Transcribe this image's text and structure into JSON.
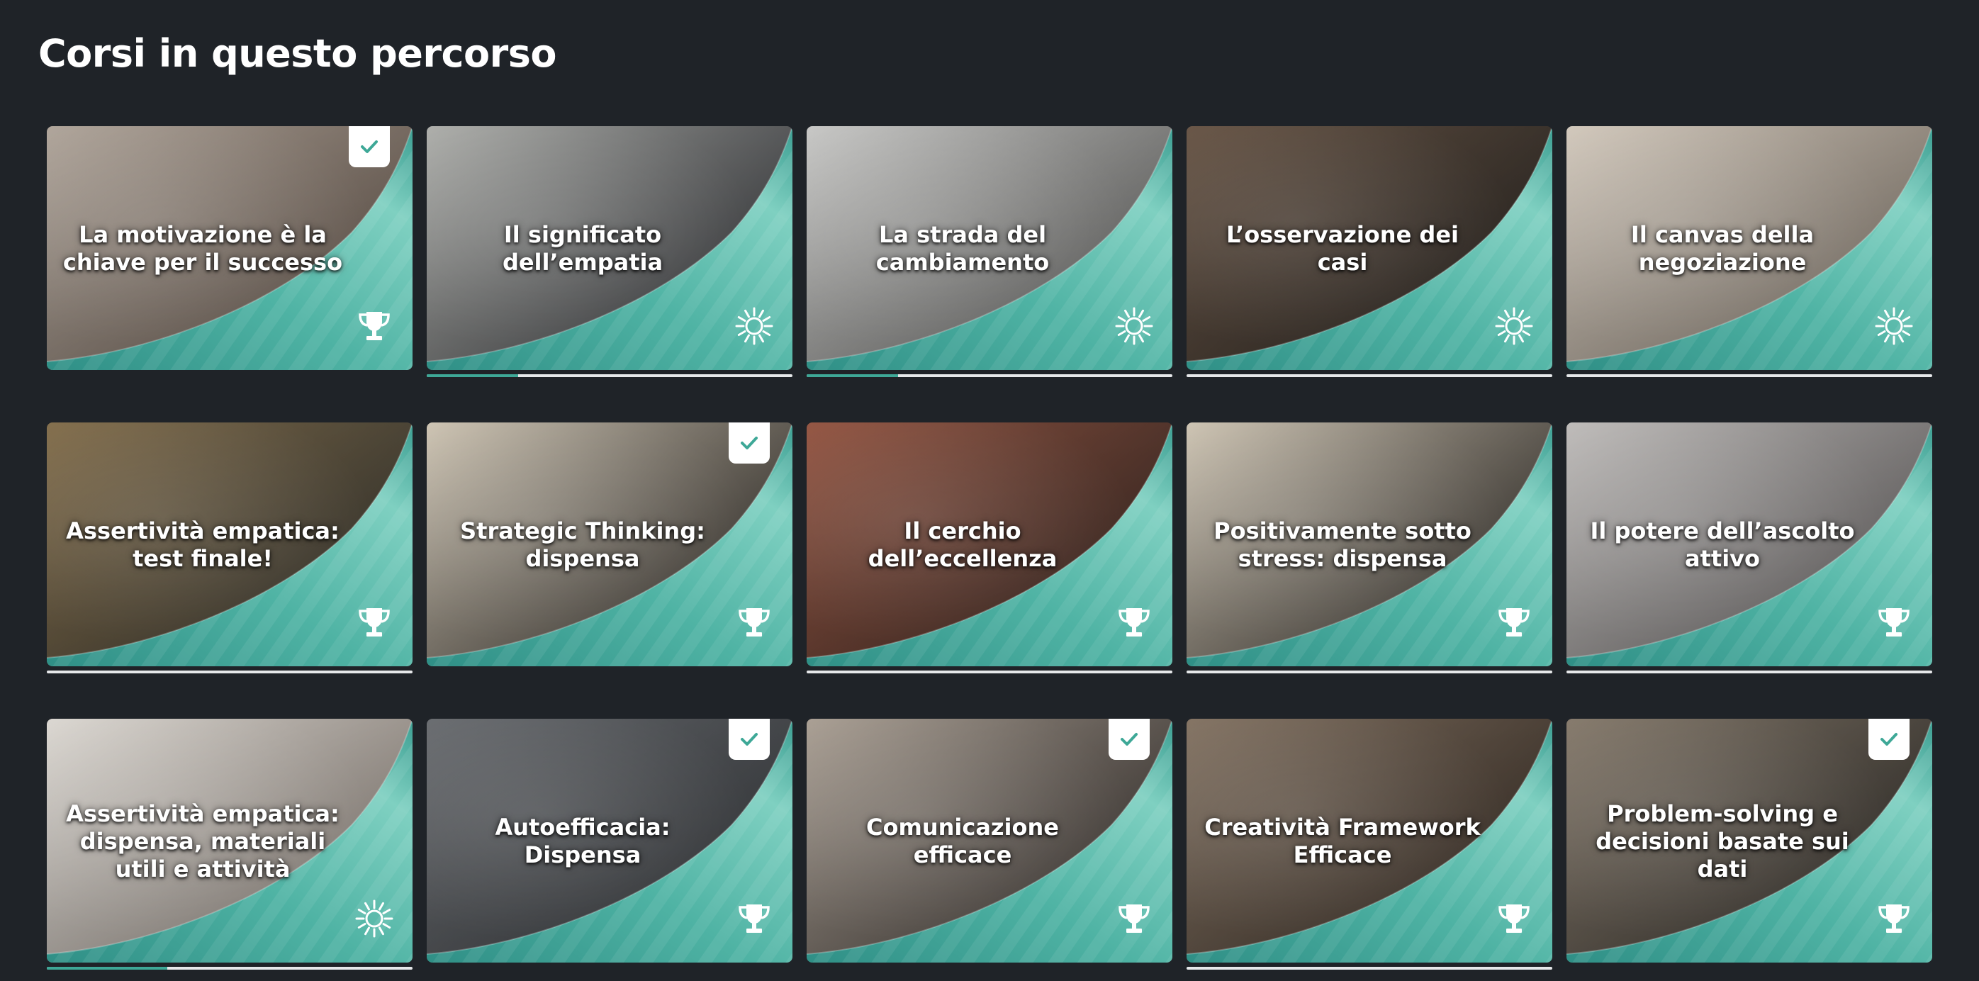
{
  "page": {
    "title": "Corsi in questo percorso"
  },
  "colors": {
    "background": "#1f2328",
    "teal_accent": "#3ea897",
    "progress_track": "#e6e8ea"
  },
  "courses": [
    {
      "title": "La motivazione è la chiave per il successo",
      "badge_icon": "trophy-icon",
      "completed": true,
      "progress": null,
      "photo": [
        "#b9aea3",
        "#6d5d52"
      ]
    },
    {
      "title": "Il significato dell’empatia",
      "badge_icon": "sun-icon",
      "completed": false,
      "progress": 0.25,
      "photo": [
        "#b7b8b4",
        "#33353a"
      ]
    },
    {
      "title": "La strada del cambiamento",
      "badge_icon": "sun-icon",
      "completed": false,
      "progress": 0.25,
      "photo": [
        "#d2d2d0",
        "#6b6b69"
      ]
    },
    {
      "title": "L’osservazione dei casi",
      "badge_icon": "sun-icon",
      "completed": false,
      "progress": 0,
      "photo": [
        "#6e5a4a",
        "#2a2724"
      ]
    },
    {
      "title": "Il canvas della negoziazione",
      "badge_icon": "sun-icon",
      "completed": false,
      "progress": 0,
      "photo": [
        "#ddd3c6",
        "#8f8478"
      ]
    },
    {
      "title": "Assertività empatica: test finale!",
      "badge_icon": "trophy-icon",
      "completed": false,
      "progress": 0,
      "photo": [
        "#8a7450",
        "#3a3a35"
      ]
    },
    {
      "title": "Strategic Thinking: dispensa",
      "badge_icon": "trophy-icon",
      "completed": true,
      "progress": null,
      "photo": [
        "#d9cfbd",
        "#2e2a26"
      ]
    },
    {
      "title": "Il cerchio dell’eccellenza",
      "badge_icon": "trophy-icon",
      "completed": false,
      "progress": 0,
      "photo": [
        "#9c5a46",
        "#3b2c27"
      ]
    },
    {
      "title": "Positivamente sotto stress: dispensa",
      "badge_icon": "trophy-icon",
      "completed": false,
      "progress": 0,
      "photo": [
        "#d9cfbd",
        "#2e2a26"
      ]
    },
    {
      "title": "Il potere dell’ascolto attivo",
      "badge_icon": "trophy-icon",
      "completed": false,
      "progress": 0,
      "photo": [
        "#c9c6c4",
        "#6f6b6b"
      ]
    },
    {
      "title": "Assertività empatica: dispensa, materiali utili e attività",
      "badge_icon": "sun-icon",
      "completed": false,
      "progress": 0.33,
      "photo": [
        "#e7e3dd",
        "#9a8f86"
      ]
    },
    {
      "title": "Autoefficacia: Dispensa",
      "badge_icon": "trophy-icon",
      "completed": true,
      "progress": null,
      "photo": [
        "#6f7276",
        "#3b3e42"
      ]
    },
    {
      "title": "Comunicazione efficace",
      "badge_icon": "trophy-icon",
      "completed": true,
      "progress": null,
      "photo": [
        "#b3a89c",
        "#3a3431"
      ]
    },
    {
      "title": "Creatività Framework Efficace",
      "badge_icon": "trophy-icon",
      "completed": false,
      "progress": 0,
      "photo": [
        "#8b7a69",
        "#3a2f27"
      ]
    },
    {
      "title": "Problem-solving e decisioni basate sui dati",
      "badge_icon": "trophy-icon",
      "completed": true,
      "progress": null,
      "photo": [
        "#8d8172",
        "#33302c"
      ]
    }
  ]
}
